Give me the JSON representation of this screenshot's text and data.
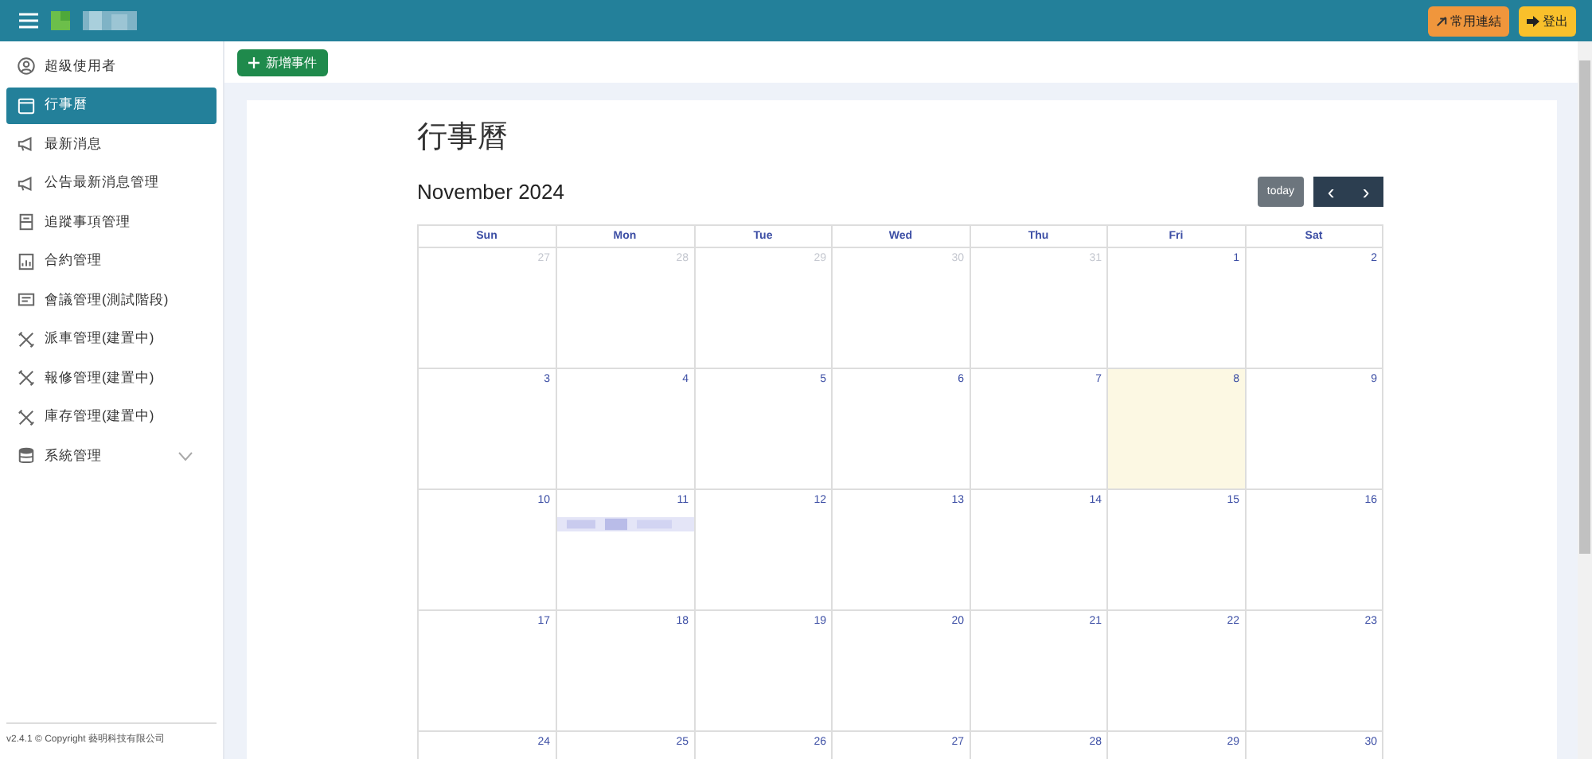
{
  "header": {
    "buttons": [
      {
        "kind": "link",
        "label": "常用連結"
      },
      {
        "kind": "logout",
        "label": "登出"
      }
    ]
  },
  "sidebar": {
    "items": [
      {
        "kind": "link",
        "label": "超級使用者",
        "selected": false
      },
      {
        "kind": "link",
        "label": "行事曆",
        "selected": true
      },
      {
        "kind": "link",
        "label": "最新消息",
        "selected": false
      },
      {
        "kind": "link",
        "label": "公告最新消息管理",
        "selected": false
      },
      {
        "kind": "link",
        "label": "追蹤事項管理",
        "selected": false
      },
      {
        "kind": "link",
        "label": "合約管理",
        "selected": false
      },
      {
        "kind": "link",
        "label": "會議管理(測試階段)",
        "selected": false
      },
      {
        "kind": "link",
        "label": "派車管理(建置中)",
        "selected": false
      },
      {
        "kind": "link",
        "label": "報修管理(建置中)",
        "selected": false
      },
      {
        "kind": "link",
        "label": "庫存管理(建置中)",
        "selected": false
      },
      {
        "kind": "group",
        "label": "系統管理",
        "selected": false,
        "expanded": false
      }
    ],
    "footer": "v2.4.1 © Copyright 藝明科技有限公司"
  },
  "toolbar": {
    "add_button": "新增事件"
  },
  "calendar": {
    "page_title": "行事曆",
    "month_title": "November 2024",
    "today_button": "today",
    "prev_button": "‹",
    "next_button": "›",
    "weekdays": [
      "Sun",
      "Mon",
      "Tue",
      "Wed",
      "Thu",
      "Fri",
      "Sat"
    ],
    "weeks": [
      [
        {
          "label": "27",
          "outside": true,
          "today": false
        },
        {
          "label": "28",
          "outside": true,
          "today": false
        },
        {
          "label": "29",
          "outside": true,
          "today": false
        },
        {
          "label": "30",
          "outside": true,
          "today": false
        },
        {
          "label": "31",
          "outside": true,
          "today": false
        },
        {
          "label": "1",
          "outside": false,
          "today": false
        },
        {
          "label": "2",
          "outside": false,
          "today": false
        }
      ],
      [
        {
          "label": "3",
          "outside": false,
          "today": false
        },
        {
          "label": "4",
          "outside": false,
          "today": false
        },
        {
          "label": "5",
          "outside": false,
          "today": false
        },
        {
          "label": "6",
          "outside": false,
          "today": false
        },
        {
          "label": "7",
          "outside": false,
          "today": false
        },
        {
          "label": "8",
          "outside": false,
          "today": true
        },
        {
          "label": "9",
          "outside": false,
          "today": false
        }
      ],
      [
        {
          "label": "10",
          "outside": false,
          "today": false
        },
        {
          "label": "11",
          "outside": false,
          "today": false,
          "events": [
            {
              "kind": "blurred"
            }
          ]
        },
        {
          "label": "12",
          "outside": false,
          "today": false
        },
        {
          "label": "13",
          "outside": false,
          "today": false
        },
        {
          "label": "14",
          "outside": false,
          "today": false
        },
        {
          "label": "15",
          "outside": false,
          "today": false
        },
        {
          "label": "16",
          "outside": false,
          "today": false
        }
      ],
      [
        {
          "label": "17",
          "outside": false,
          "today": false
        },
        {
          "label": "18",
          "outside": false,
          "today": false
        },
        {
          "label": "19",
          "outside": false,
          "today": false
        },
        {
          "label": "20",
          "outside": false,
          "today": false
        },
        {
          "label": "21",
          "outside": false,
          "today": false
        },
        {
          "label": "22",
          "outside": false,
          "today": false
        },
        {
          "label": "23",
          "outside": false,
          "today": false
        }
      ],
      [
        {
          "label": "24",
          "outside": false,
          "today": false
        },
        {
          "label": "25",
          "outside": false,
          "today": false
        },
        {
          "label": "26",
          "outside": false,
          "today": false
        },
        {
          "label": "27",
          "outside": false,
          "today": false
        },
        {
          "label": "28",
          "outside": false,
          "today": false
        },
        {
          "label": "29",
          "outside": false,
          "today": false
        },
        {
          "label": "30",
          "outside": false,
          "today": false
        }
      ]
    ]
  }
}
